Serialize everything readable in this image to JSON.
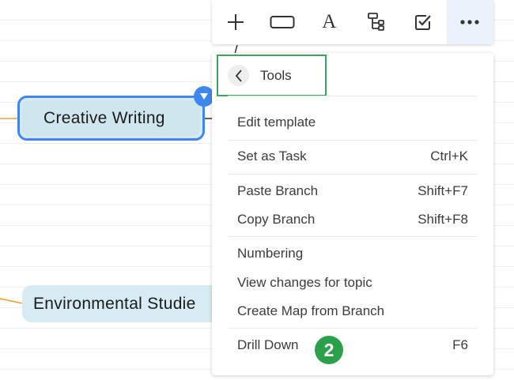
{
  "toolbar": {
    "buttons": [
      {
        "icon": "plus-icon"
      },
      {
        "icon": "topic-shape-icon"
      },
      {
        "icon": "text-style-icon",
        "glyph": "A"
      },
      {
        "icon": "structure-icon"
      },
      {
        "icon": "task-checkbox-icon"
      },
      {
        "icon": "more-icon",
        "active": true
      }
    ]
  },
  "topics": {
    "creative_writing": "Creative Writing",
    "environmental_studies": "Environmental Studie"
  },
  "menu": {
    "header": {
      "label": "Tools",
      "icon": "chevron-left-icon"
    },
    "groups": [
      [
        {
          "label": "Edit template",
          "shortcut": ""
        }
      ],
      [
        {
          "label": "Set as Task",
          "shortcut": "Ctrl+K"
        }
      ],
      [
        {
          "label": "Paste Branch",
          "shortcut": "Shift+F7"
        },
        {
          "label": "Copy Branch",
          "shortcut": "Shift+F8"
        }
      ],
      [
        {
          "label": "Numbering",
          "shortcut": ""
        },
        {
          "label": "View changes for topic",
          "shortcut": ""
        },
        {
          "label": "Create Map from Branch",
          "shortcut": ""
        }
      ],
      [
        {
          "label": "Drill Down",
          "shortcut": "F6"
        }
      ]
    ]
  },
  "step_badge": "2",
  "colors": {
    "selection_blue": "#3f86f0",
    "topic_fill": "#d6ebf3",
    "branch_orange": "#e8a33a",
    "highlight_green": "#3aa55c",
    "badge_green": "#2aa04a"
  }
}
